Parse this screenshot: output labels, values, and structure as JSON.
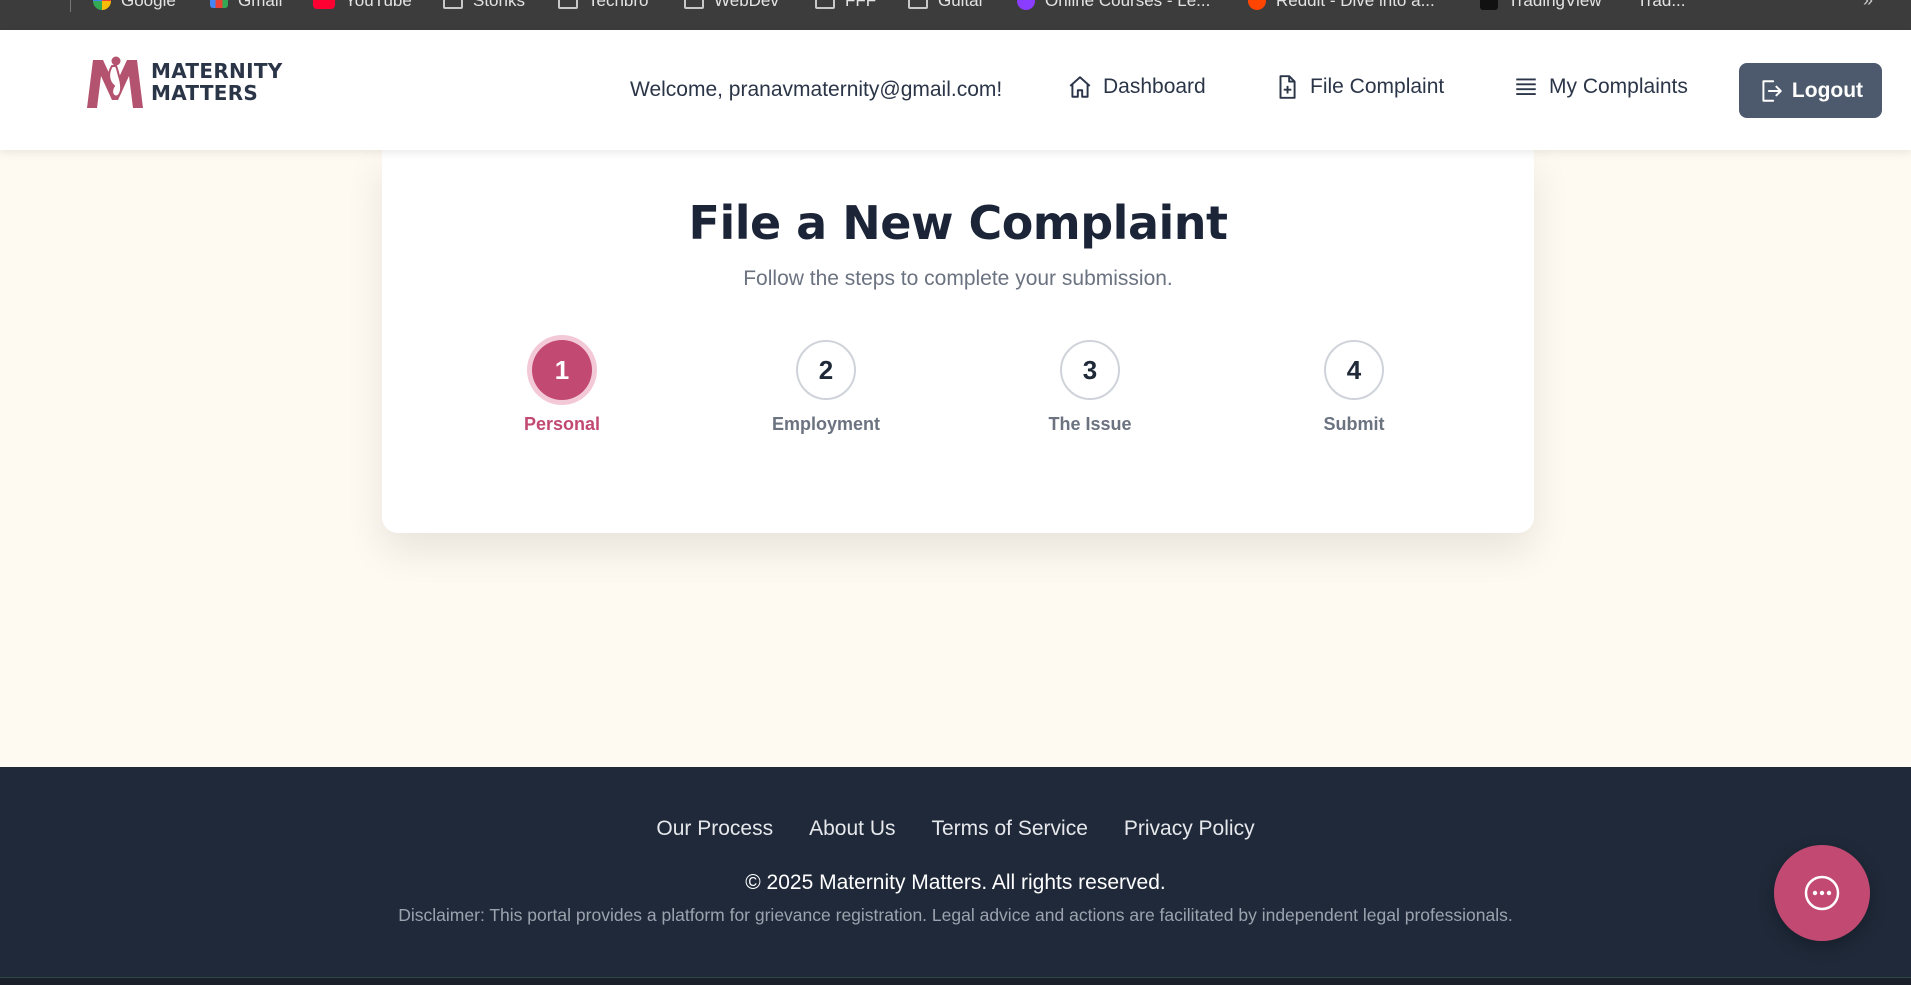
{
  "browser": {
    "bookmarks": [
      {
        "label": "Google",
        "icon": "google-icon"
      },
      {
        "label": "Gmail",
        "icon": "gmail-icon"
      },
      {
        "label": "YouTube",
        "icon": "youtube-icon"
      },
      {
        "label": "Stonks",
        "icon": "folder-icon"
      },
      {
        "label": "Techbro",
        "icon": "folder-icon"
      },
      {
        "label": "WebDev",
        "icon": "folder-icon"
      },
      {
        "label": "FFF",
        "icon": "folder-icon"
      },
      {
        "label": "Guitar",
        "icon": "folder-icon"
      },
      {
        "label": "Online Courses - Le...",
        "icon": "course-icon"
      },
      {
        "label": "Reddit - Dive into a...",
        "icon": "reddit-icon"
      },
      {
        "label": "TradingView",
        "icon": "tradingview-icon"
      },
      {
        "label": "Trad...",
        "icon": ""
      }
    ]
  },
  "header": {
    "logo_line1": "MATERNITY",
    "logo_line2": "MATTERS",
    "welcome": "Welcome, pranavmaternity@gmail.com!",
    "nav": {
      "dashboard": "Dashboard",
      "file_complaint": "File Complaint",
      "my_complaints": "My Complaints"
    },
    "logout": "Logout"
  },
  "card": {
    "title": "File a New Complaint",
    "subtitle": "Follow the steps to complete your submission.",
    "current_step": 1,
    "steps": [
      {
        "number": "1",
        "label": "Personal"
      },
      {
        "number": "2",
        "label": "Employment"
      },
      {
        "number": "3",
        "label": "The Issue"
      },
      {
        "number": "4",
        "label": "Submit"
      }
    ]
  },
  "footer": {
    "links": [
      "Our Process",
      "About Us",
      "Terms of Service",
      "Privacy Policy"
    ],
    "copyright": "© 2025 Maternity Matters. All rights reserved.",
    "disclaimer": "Disclaimer: This portal provides a platform for grievance registration. Legal advice and actions are facilitated by independent legal professionals."
  },
  "colors": {
    "brand": "#c24a72",
    "dark": "#1f2939",
    "background": "#fefaf2",
    "logout_bg": "#4d5a6d"
  }
}
